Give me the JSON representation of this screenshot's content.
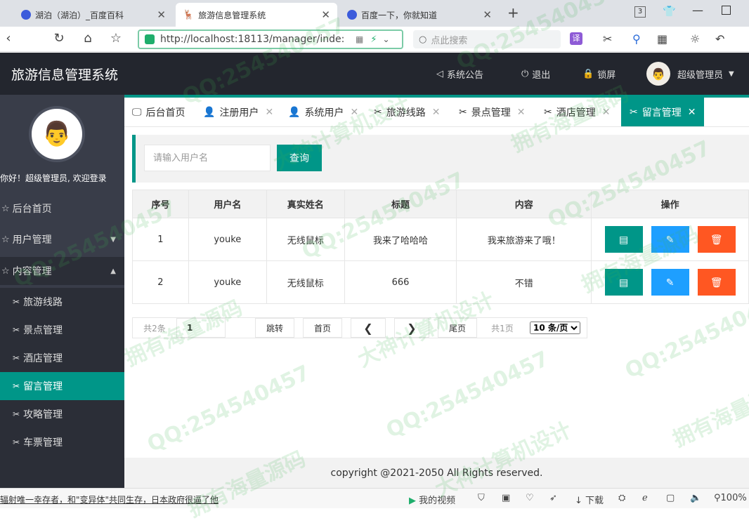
{
  "browser": {
    "tabs": [
      {
        "title": "湖泊（湖泊）_百度百科",
        "close": "✕"
      },
      {
        "title": "旅游信息管理系统",
        "close": "✕"
      },
      {
        "title": "百度一下，你就知道",
        "close": "✕"
      }
    ],
    "new_tab": "+",
    "tab_count": "3",
    "url": "http://localhost:18113/manager/inde:",
    "search_placeholder": "点此搜索"
  },
  "header": {
    "title": "旅游信息管理系统",
    "notice": "系统公告",
    "logout": "退出",
    "lock": "锁屏",
    "user": "超级管理员"
  },
  "sidebar": {
    "welcome": "你好！超级管理员, 欢迎登录",
    "home": "后台首页",
    "user_mgmt": "用户管理",
    "content_mgmt": "内容管理",
    "subitems": [
      "旅游线路",
      "景点管理",
      "酒店管理",
      "留言管理",
      "攻略管理",
      "车票管理"
    ]
  },
  "page_tabs": [
    "后台首页",
    "注册用户",
    "系统用户",
    "旅游线路",
    "景点管理",
    "酒店管理",
    "留言管理"
  ],
  "search": {
    "placeholder": "请输入用户名",
    "button": "查询"
  },
  "table": {
    "headers": [
      "序号",
      "用户名",
      "真实姓名",
      "标题",
      "内容",
      "操作"
    ],
    "rows": [
      {
        "no": "1",
        "username": "youke",
        "realname": "无线鼠标",
        "title": "我来了哈哈哈",
        "content": "我来旅游来了哦！"
      },
      {
        "no": "2",
        "username": "youke",
        "realname": "无线鼠标",
        "title": "666",
        "content": "不错"
      }
    ]
  },
  "pager": {
    "total": "共2条",
    "page_value": "1",
    "jump": "跳转",
    "first": "首页",
    "prev": "❮",
    "next": "❯",
    "last": "尾页",
    "pages": "共1页",
    "page_size": "10 条/页"
  },
  "footer": "copyright @2021-2050 All Rights reserved.",
  "statusbar": {
    "news": "辐射唯一幸存者，和\"变异体\"共同生存，日本政府很逼了他",
    "video": "我的视频",
    "download": "下载",
    "zoom": "100%"
  },
  "watermarks": [
    "QQ:254540457",
    "大神计算机设计",
    "拥有海量源码"
  ]
}
